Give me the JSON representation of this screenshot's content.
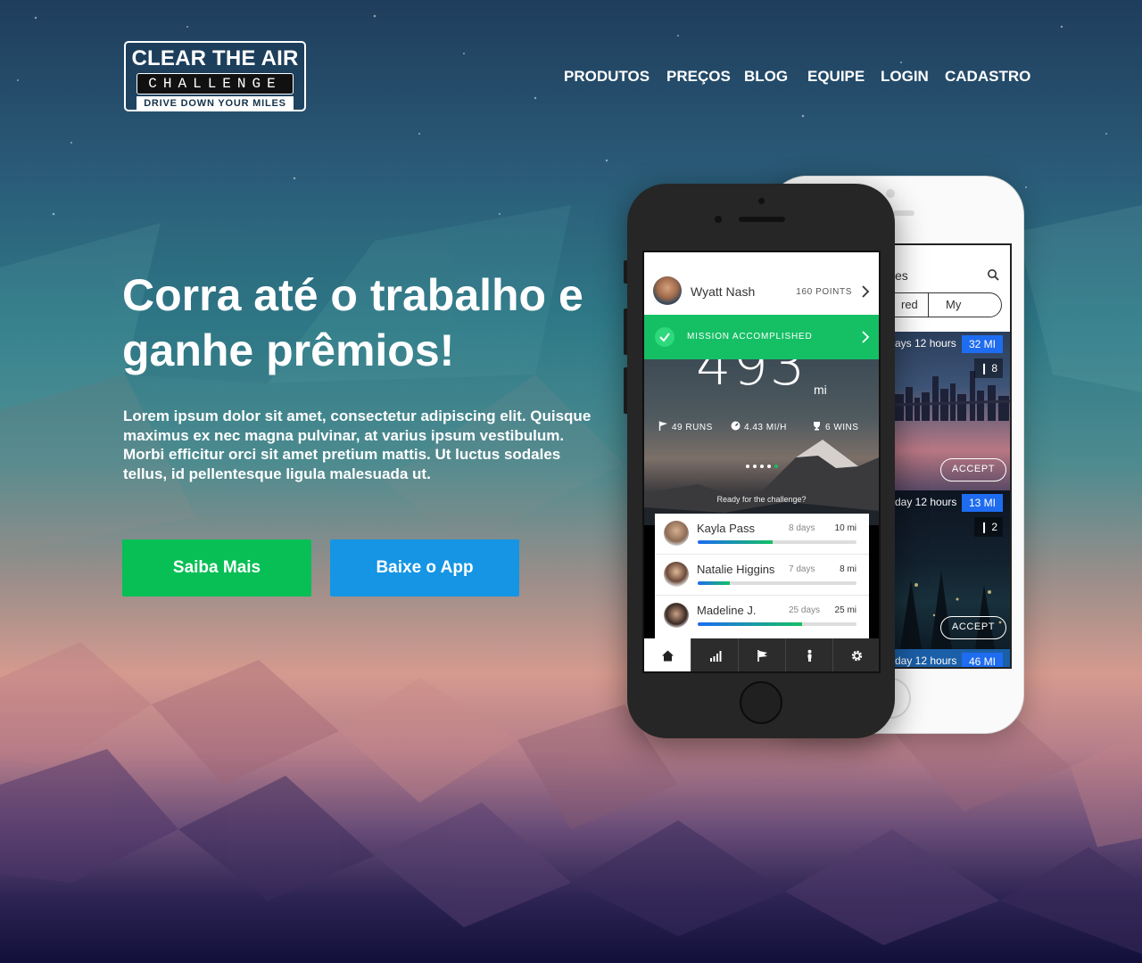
{
  "brand": {
    "line1": "CLEAR THE AIR",
    "line2": "CHALLENGE",
    "tagline": "DRIVE DOWN YOUR MILES"
  },
  "nav": {
    "items": [
      "PRODUTOS",
      "PREÇOS",
      "BLOG",
      "EQUIPE",
      "LOGIN",
      "CADASTRO"
    ]
  },
  "hero": {
    "title": "Corra até o trabalho e ganhe prêmios!",
    "text": "Lorem ipsum dolor sit amet, consectetur adipiscing elit. Quisque maximus ex nec magna pulvinar, at varius ipsum vestibulum. Morbi efficitur orci sit amet pretium mattis. Ut luctus sodales tellus, id pellentesque ligula malesuada ut.",
    "primary_button": "Saiba Mais",
    "secondary_button": "Baixe o App"
  },
  "back_phone": {
    "title_partial": "es",
    "segment_left": "red",
    "segment_right": "My",
    "cards": [
      {
        "meta": "ays 12 hours",
        "miles": "32 MI",
        "people": "8",
        "accept": "ACCEPT"
      },
      {
        "meta": "day 12 hours",
        "miles": "13 MI",
        "people": "2",
        "accept": "ACCEPT"
      },
      {
        "meta": "day 12 hours",
        "miles": "46 MI"
      }
    ]
  },
  "front_phone": {
    "user_name": "Wyatt Nash",
    "points": "160 POINTS",
    "mission": "MISSION ACCOMPLISHED",
    "distance": "493",
    "distance_unit": "mi",
    "stats": {
      "runs": "49 RUNS",
      "speed": "4.43 MI/H",
      "wins": "6 WINS"
    },
    "prompt": "Ready for the challenge?",
    "leaderboard": [
      {
        "name": "Kayla Pass",
        "days": "8 days",
        "miles": "10 mi",
        "progress": 0.47
      },
      {
        "name": "Natalie Higgins",
        "days": "7 days",
        "miles": "8 mi",
        "progress": 0.2
      },
      {
        "name": "Madeline J.",
        "days": "25 days",
        "miles": "25 mi",
        "progress": 0.66
      }
    ],
    "tabs": [
      "home-icon",
      "stats-icon",
      "flag-icon",
      "person-icon",
      "settings-icon"
    ]
  },
  "colors": {
    "accent_green": "#07bf55",
    "accent_blue": "#1595e4",
    "mission_green": "#15c065",
    "mile_badge_blue": "#1e6cf0"
  }
}
